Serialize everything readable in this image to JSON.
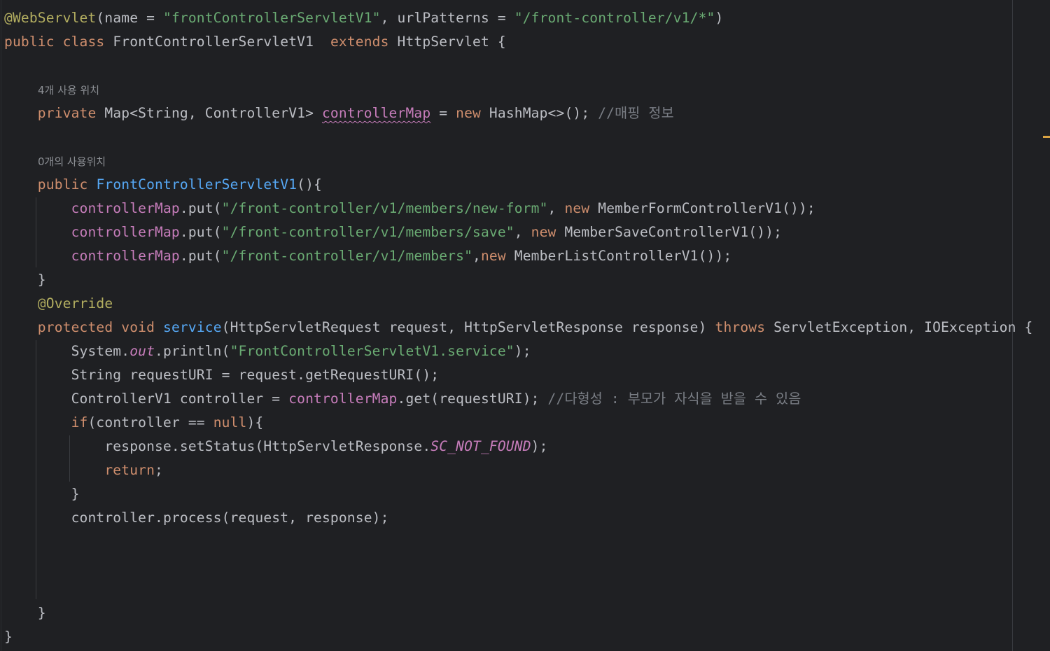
{
  "hints": {
    "usage_4": "4개 사용 위치",
    "usage_0": "0개의 사용위치"
  },
  "code": {
    "l1": {
      "annotation": "@WebServlet",
      "p1": "(name = ",
      "s1": "\"frontControllerServletV1\"",
      "p2": ", urlPatterns = ",
      "s2": "\"/front-controller/v1/*\"",
      "p3": ")"
    },
    "l2": {
      "kw1": "public",
      "sp1": " ",
      "kw2": "class",
      "t1": " FrontControllerServletV1  ",
      "kw3": "extends",
      "t2": " HttpServlet {"
    },
    "l3": {
      "indent": "    ",
      "kw1": "private",
      "t1": " Map<String, ControllerV1> ",
      "field": "controllerMap",
      "t2": " = ",
      "kw2": "new",
      "t3": " HashMap<>(); ",
      "comment": "//매핑 정보"
    },
    "l4": {
      "indent": "    ",
      "kw1": "public",
      "sp": " ",
      "ctor": "FrontControllerServletV1",
      "t1": "(){"
    },
    "l5": {
      "indent": "        ",
      "field": "controllerMap",
      "t1": ".put(",
      "str": "\"/front-controller/v1/members/new-form\"",
      "t2": ", ",
      "kw": "new",
      "t3": " MemberFormControllerV1());"
    },
    "l6": {
      "indent": "        ",
      "field": "controllerMap",
      "t1": ".put(",
      "str": "\"/front-controller/v1/members/save\"",
      "t2": ", ",
      "kw": "new",
      "t3": " MemberSaveControllerV1());"
    },
    "l7": {
      "indent": "        ",
      "field": "controllerMap",
      "t1": ".put(",
      "str": "\"/front-controller/v1/members\"",
      "t2": ",",
      "kw": "new",
      "t3": " MemberListControllerV1());"
    },
    "l8": {
      "text": "    }"
    },
    "l9": {
      "indent": "    ",
      "annotation": "@Override"
    },
    "l10": {
      "indent": "    ",
      "kw1": "protected",
      "sp": " ",
      "kw2": "void",
      "sp2": " ",
      "method": "service",
      "t1": "(HttpServletRequest request, HttpServletResponse response) ",
      "kw3": "throws",
      "t2": " ServletException, IOException {"
    },
    "l11": {
      "indent": "        ",
      "t1": "System.",
      "sfield": "out",
      "t2": ".println(",
      "str": "\"FrontControllerServletV1.service\"",
      "t3": ");"
    },
    "l12": {
      "text": "        String requestURI = request.getRequestURI();"
    },
    "l13": {
      "indent": "        ",
      "t1": "ControllerV1 controller = ",
      "field": "controllerMap",
      "t2": ".get(requestURI); ",
      "comment": "//다형성 : 부모가 자식을 받을 수 있음"
    },
    "l14": {
      "indent": "        ",
      "kw1": "if",
      "t1": "(controller == ",
      "kw2": "null",
      "t2": "){"
    },
    "l15": {
      "indent": "            ",
      "t1": "response.setStatus(HttpServletResponse.",
      "sfield": "SC_NOT_FOUND",
      "t2": ");"
    },
    "l16": {
      "indent": "            ",
      "kw": "return",
      "t1": ";"
    },
    "l17": {
      "text": "        }"
    },
    "l18": {
      "text": "        controller.process(request, response);"
    },
    "l19": {
      "text": "    }"
    },
    "l20": {
      "text": "}"
    }
  },
  "colors": {
    "background": "#1f2023",
    "default_text": "#bcbec4",
    "keyword": "#cf8e6d",
    "annotation": "#b3ae60",
    "string": "#6aab73",
    "field": "#c77dbb",
    "function": "#56a8f5",
    "comment": "#7a7e85",
    "hint": "#8c8f94",
    "warning_marker": "#d9a343"
  }
}
